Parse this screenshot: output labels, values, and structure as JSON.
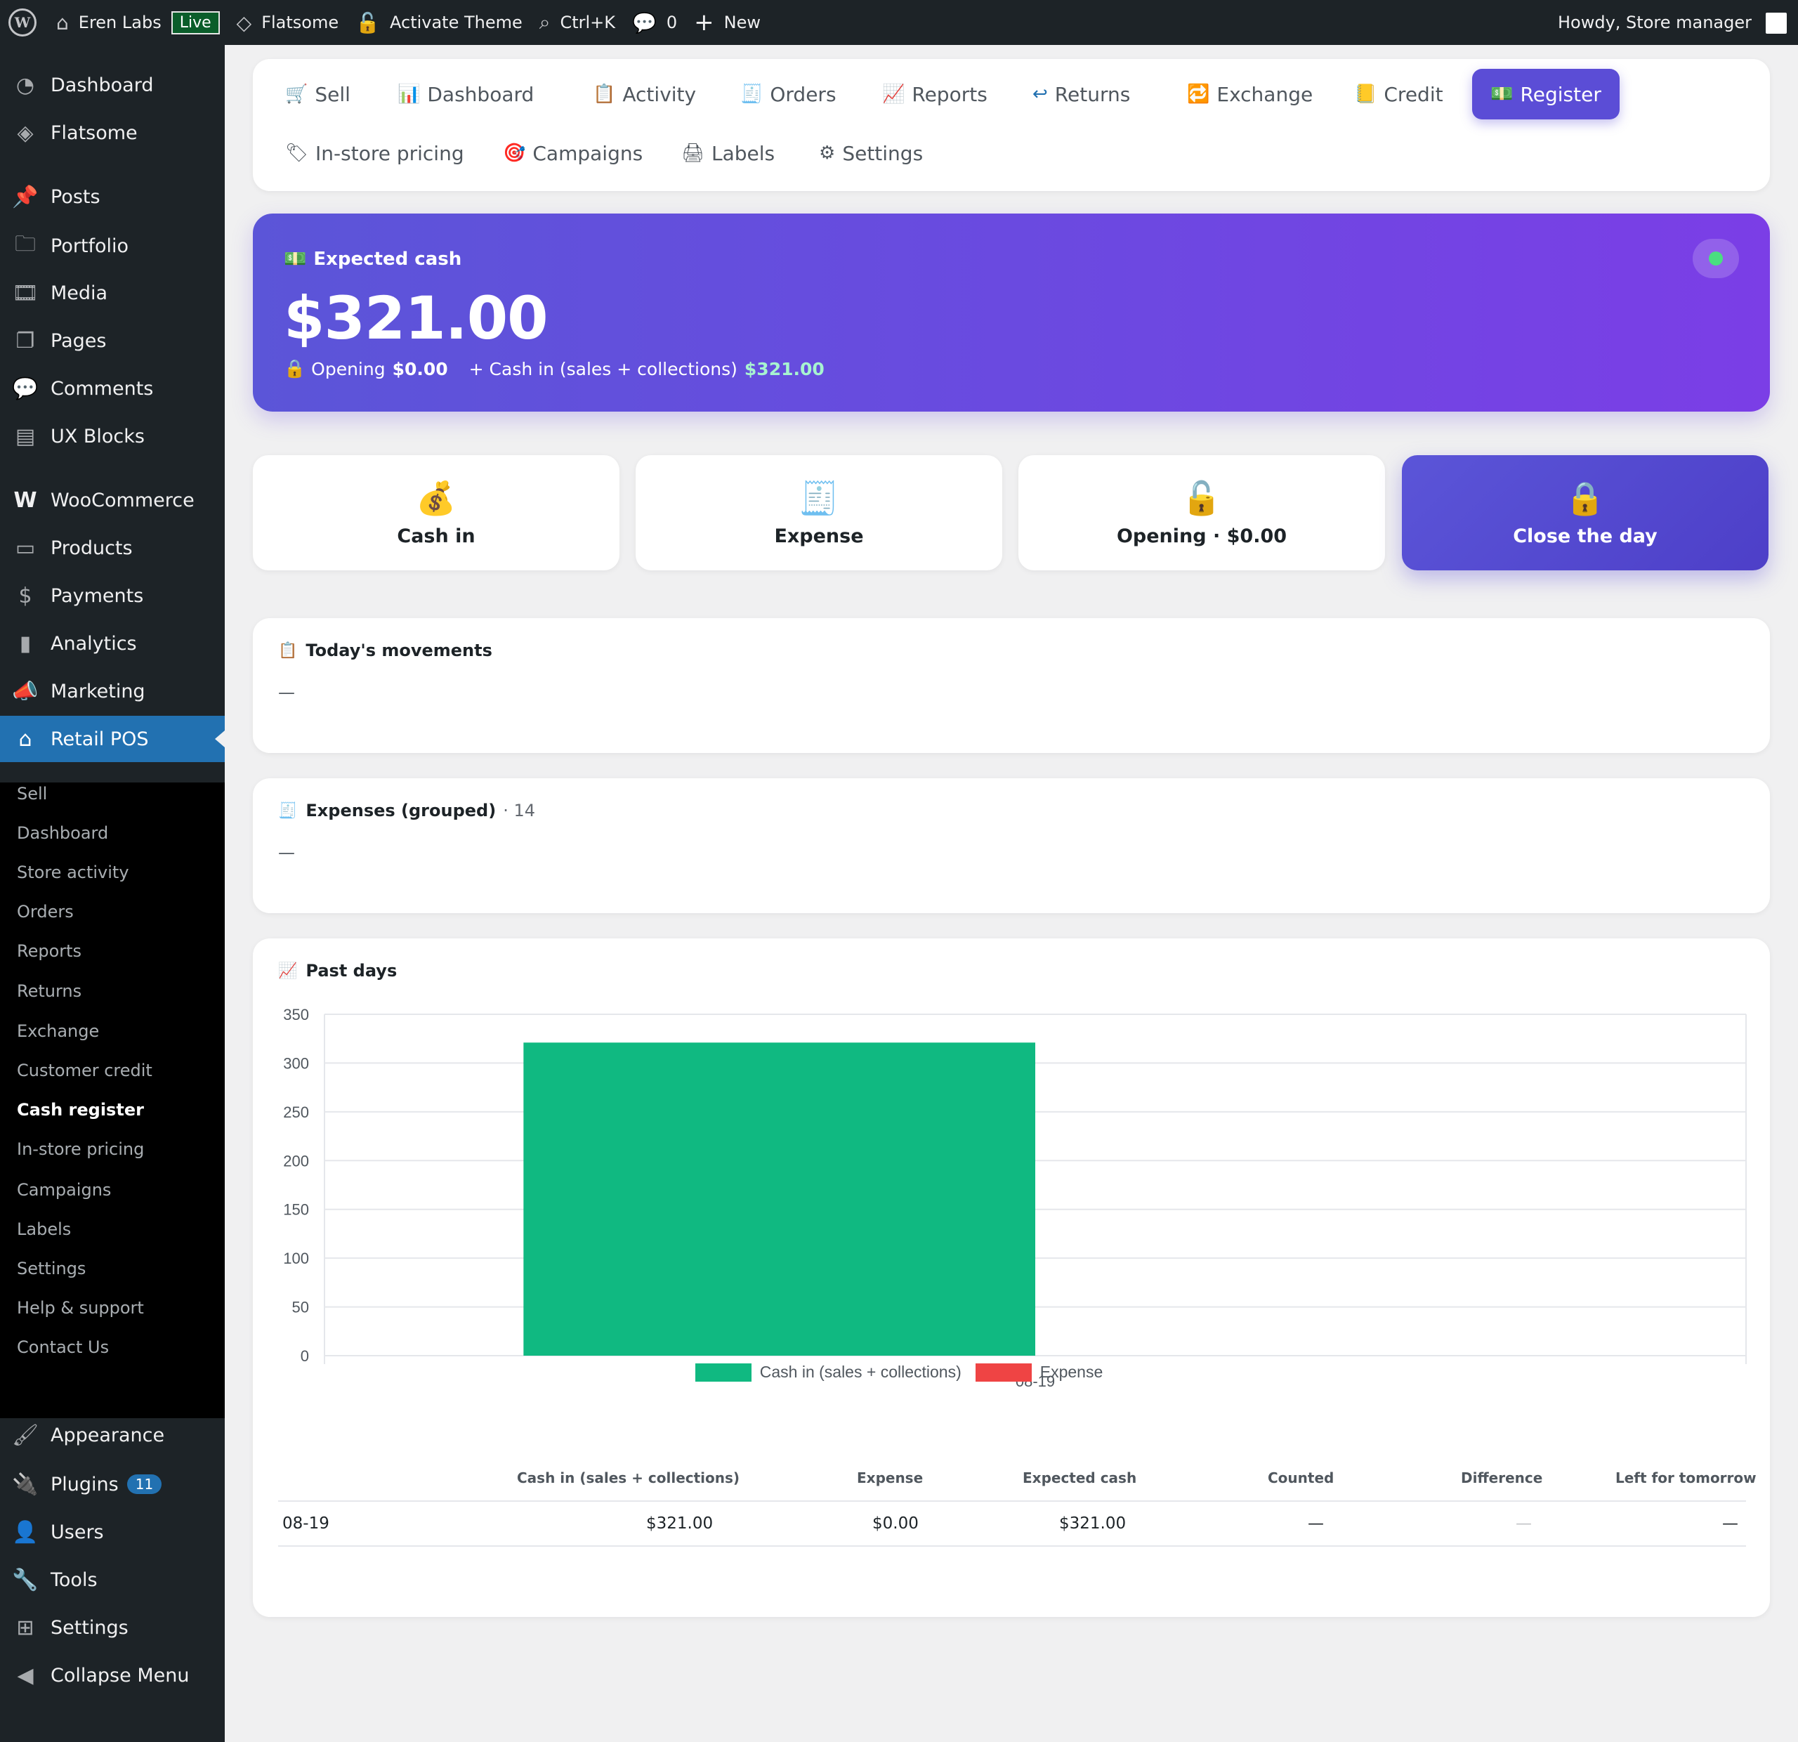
{
  "adminbar": {
    "site_name": "Eren Labs",
    "live_badge": "Live",
    "theme": "Flatsome",
    "activate_theme": "Activate Theme",
    "search_shortcut": "Ctrl+K",
    "comments_count": "0",
    "new_label": "New",
    "howdy": "Howdy, Store manager"
  },
  "sidebar": {
    "items": [
      {
        "label": "Dashboard",
        "icon": "gauge-icon"
      },
      {
        "label": "Flatsome",
        "icon": "diamond-icon"
      },
      {
        "label": "Posts",
        "icon": "pin-icon"
      },
      {
        "label": "Portfolio",
        "icon": "folder-icon"
      },
      {
        "label": "Media",
        "icon": "media-icon"
      },
      {
        "label": "Pages",
        "icon": "pages-icon"
      },
      {
        "label": "Comments",
        "icon": "comment-icon"
      },
      {
        "label": "UX Blocks",
        "icon": "blocks-icon"
      },
      {
        "label": "WooCommerce",
        "icon": "woo-icon"
      },
      {
        "label": "Products",
        "icon": "archive-icon"
      },
      {
        "label": "Payments",
        "icon": "dollar-icon"
      },
      {
        "label": "Analytics",
        "icon": "bar-chart-icon"
      },
      {
        "label": "Marketing",
        "icon": "megaphone-icon"
      },
      {
        "label": "Retail POS",
        "icon": "store-icon"
      }
    ],
    "submenu": [
      "Sell",
      "Dashboard",
      "Store activity",
      "Orders",
      "Reports",
      "Returns",
      "Exchange",
      "Customer credit",
      "Cash register",
      "In-store pricing",
      "Campaigns",
      "Labels",
      "Settings",
      "Help & support",
      "Contact Us"
    ],
    "bottom": [
      {
        "label": "Appearance",
        "icon": "brush-icon"
      },
      {
        "label": "Plugins",
        "icon": "plug-icon",
        "badge": "11"
      },
      {
        "label": "Users",
        "icon": "user-icon"
      },
      {
        "label": "Tools",
        "icon": "wrench-icon"
      },
      {
        "label": "Settings",
        "icon": "settings-icon"
      },
      {
        "label": "Collapse Menu",
        "icon": "collapse-icon"
      }
    ]
  },
  "tabs": [
    {
      "label": "Sell",
      "icon": "🛒"
    },
    {
      "label": "Dashboard",
      "icon": "📊"
    },
    {
      "label": "Activity",
      "icon": "📋"
    },
    {
      "label": "Orders",
      "icon": "🧾"
    },
    {
      "label": "Reports",
      "icon": "📈"
    },
    {
      "label": "Returns",
      "icon": "↩"
    },
    {
      "label": "Exchange",
      "icon": "🔁"
    },
    {
      "label": "Credit",
      "icon": "📒"
    },
    {
      "label": "Register",
      "icon": "💵"
    },
    {
      "label": "In-store pricing",
      "icon": "🏷"
    },
    {
      "label": "Campaigns",
      "icon": "🎯"
    },
    {
      "label": "Labels",
      "icon": "🖨"
    },
    {
      "label": "Settings",
      "icon": "⚙"
    }
  ],
  "hero": {
    "label": "Expected cash",
    "amount": "$321.00",
    "opening_label": "Opening",
    "opening_value": "$0.00",
    "cashin_label": "+ Cash in (sales + collections)",
    "cashin_value": "$321.00"
  },
  "actions": {
    "cash_in": "Cash in",
    "expense": "Expense",
    "opening": "Opening · $0.00",
    "close_day": "Close the day"
  },
  "movements": {
    "title": "Today's movements",
    "empty": "—"
  },
  "expenses": {
    "title": "Expenses (grouped)",
    "extra": "· 14",
    "empty": "—"
  },
  "past_days": {
    "title": "Past days"
  },
  "chart_data": {
    "type": "bar",
    "categories": [
      "08-19"
    ],
    "series": [
      {
        "name": "Cash in (sales + collections)",
        "values": [
          321
        ],
        "color": "#10b981"
      },
      {
        "name": "Expense",
        "values": [
          0
        ],
        "color": "#ef4444"
      }
    ],
    "yticks": [
      "0",
      "50",
      "100",
      "150",
      "200",
      "250",
      "300",
      "350"
    ],
    "ylim": [
      0,
      350
    ],
    "grid": true,
    "legend": "bottom"
  },
  "table": {
    "headers": [
      "Cash in (sales + collections)",
      "Expense",
      "Expected cash",
      "Counted",
      "Difference",
      "Left for tomorrow"
    ],
    "rows": [
      [
        "08-19",
        "$321.00",
        "$0.00",
        "$321.00",
        "—",
        "—",
        "—"
      ]
    ]
  }
}
